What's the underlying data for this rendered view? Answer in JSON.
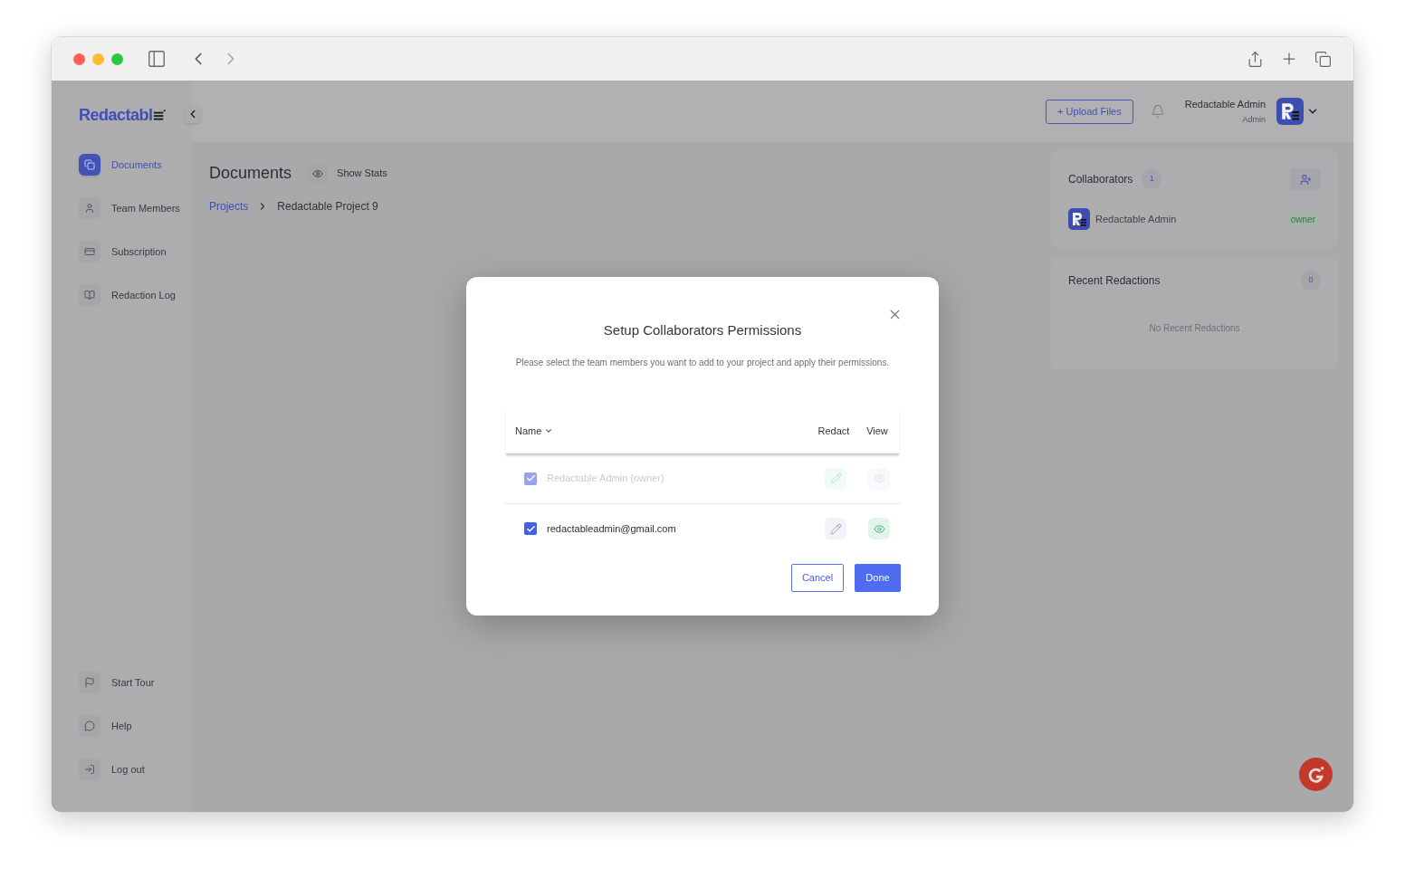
{
  "sidebar": {
    "logo_text": "Redactabl",
    "items": [
      {
        "label": "Documents",
        "kind": "documents",
        "selected": true
      },
      {
        "label": "Team Members",
        "kind": "members",
        "selected": false
      },
      {
        "label": "Subscription",
        "kind": "subscription",
        "selected": false
      },
      {
        "label": "Redaction Log",
        "kind": "log",
        "selected": false
      }
    ],
    "bottom_items": [
      {
        "label": "Start Tour",
        "kind": "tour"
      },
      {
        "label": "Help",
        "kind": "help"
      },
      {
        "label": "Log out",
        "kind": "logout"
      }
    ]
  },
  "header": {
    "upload_button": "+ Upload Files",
    "user": {
      "name": "Redactable Admin",
      "role": "Admin"
    }
  },
  "page": {
    "title": "Documents",
    "show_stats": "Show Stats",
    "breadcrumb": [
      {
        "label": "Projects",
        "kind": "link"
      },
      {
        "label": "Redactable Project 9",
        "kind": "current"
      }
    ]
  },
  "collaborators": {
    "title": "Collaborators",
    "count": "1",
    "members": [
      {
        "name": "Redactable Admin",
        "role": "owner"
      }
    ]
  },
  "recent_redactions": {
    "title": "Recent Redactions",
    "count": "0",
    "empty": "No Recent Redactions"
  },
  "modal": {
    "title": "Setup Collaborators Permissions",
    "description": "Please select the team members you want to add to your project and apply their permissions.",
    "columns": {
      "name": "Name",
      "redact": "Redact",
      "view": "View"
    },
    "rows": [
      {
        "name": "Redactable Admin (owner)",
        "checked": true,
        "disabled": true,
        "redact": true,
        "view": false
      },
      {
        "name": "redactableadmin@gmail.com",
        "checked": true,
        "disabled": false,
        "redact": false,
        "view": true
      }
    ],
    "buttons": {
      "cancel": "Cancel",
      "done": "Done"
    }
  }
}
